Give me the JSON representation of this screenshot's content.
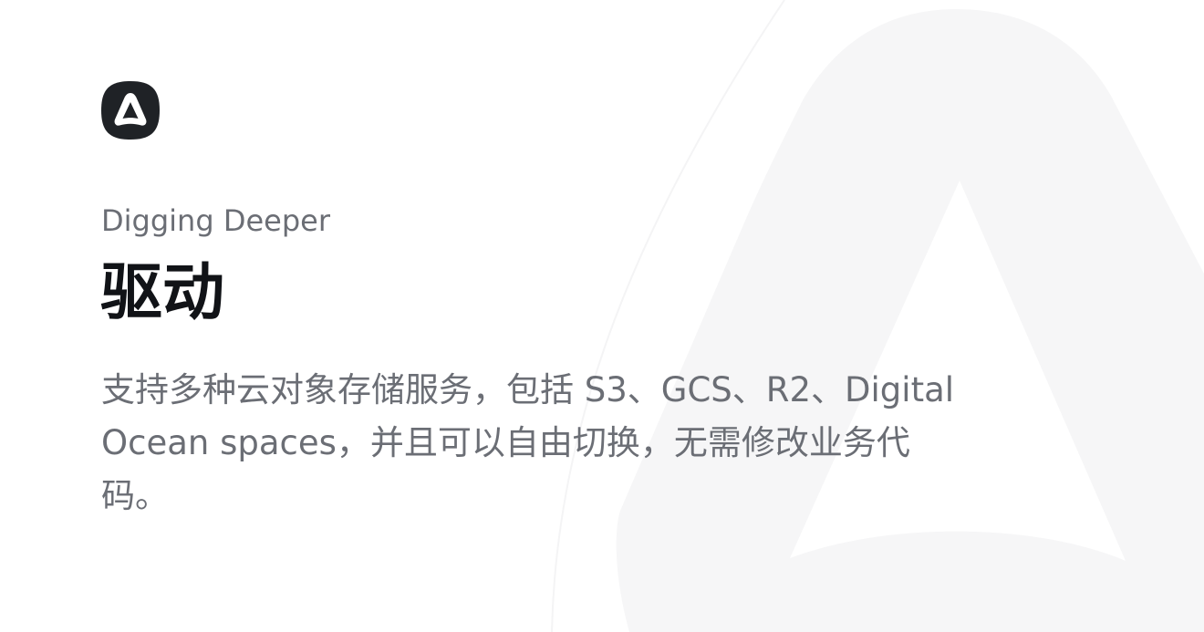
{
  "slide": {
    "eyebrow": "Digging Deeper",
    "title": "驱动",
    "description": "支持多种云对象存储服务，包括 S3、GCS、R2、Digital Ocean spaces，并且可以自由切换，无需修改业务代码。"
  },
  "icons": {
    "brand": "adonis-a-logo-icon",
    "background": "adonis-a-watermark-icon"
  },
  "colors": {
    "page_background": "#ffffff",
    "brand_tile": "#1f2226",
    "watermark": "#f6f6f7",
    "eyebrow_text": "#6b6e75",
    "title_text": "#111317",
    "body_text": "#6b6e75"
  }
}
